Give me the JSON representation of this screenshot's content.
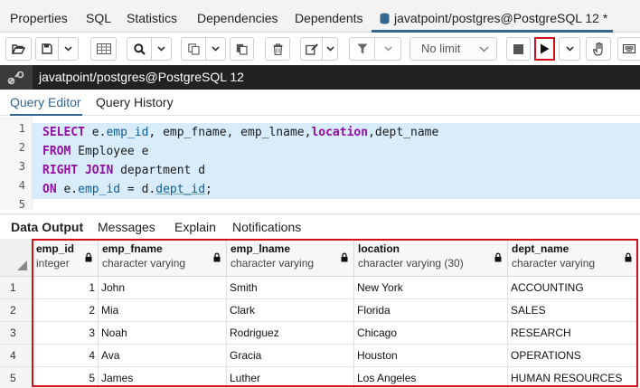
{
  "top_tabs": [
    "Properties",
    "SQL",
    "Statistics",
    "Dependencies",
    "Dependents"
  ],
  "active_tab": {
    "label": "javatpoint/postgres@PostgreSQL 12 *",
    "icon": "database-icon"
  },
  "toolbar": {
    "limit_label": "No limit",
    "icons": [
      "open-file-icon",
      "save-icon",
      "chevron-down-icon",
      "grid-icon",
      "search-icon",
      "copy-icon",
      "paste-icon",
      "delete-icon",
      "edit-icon",
      "filter-icon",
      "stop-icon",
      "play-icon",
      "hand-icon",
      "keyboard-icon"
    ]
  },
  "connection": {
    "label": "javatpoint/postgres@PostgreSQL 12",
    "icon": "link-icon"
  },
  "editor_tabs": [
    "Query Editor",
    "Query History"
  ],
  "editor": {
    "line_numbers": [
      "1",
      "2",
      "3",
      "4",
      "5"
    ]
  },
  "output_tabs": [
    "Data Output",
    "Messages",
    "Explain",
    "Notifications"
  ],
  "grid": {
    "columns": [
      {
        "name": "emp_id",
        "type": "integer"
      },
      {
        "name": "emp_fname",
        "type": "character varying"
      },
      {
        "name": "emp_lname",
        "type": "character varying"
      },
      {
        "name": "location",
        "type": "character varying (30)"
      },
      {
        "name": "dept_name",
        "type": "character varying"
      }
    ],
    "row_numbers": [
      "1",
      "2",
      "3",
      "4",
      "5"
    ],
    "rows": [
      [
        "1",
        "John",
        "Smith",
        "New York",
        "ACCOUNTING"
      ],
      [
        "2",
        "Mia",
        "Clark",
        "Florida",
        "SALES"
      ],
      [
        "3",
        "Noah",
        "Rodriguez",
        "Chicago",
        "RESEARCH"
      ],
      [
        "4",
        "Ava",
        "Gracia",
        "Houston",
        "OPERATIONS"
      ],
      [
        "5",
        "James",
        "Luther",
        "Los Angeles",
        "HUMAN RESOURCES"
      ]
    ]
  },
  "colors": {
    "accent": "#326690",
    "highlight": "#d0101b",
    "keyword": "#930da5"
  }
}
